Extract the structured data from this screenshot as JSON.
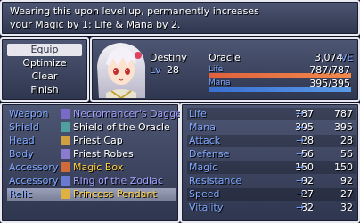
{
  "help": {
    "line1": "Wearing this upon level up, permanently increases",
    "line2": "your Magic by 1: Life & Mana by 2."
  },
  "commands": [
    "Equip",
    "Optimize",
    "Clear",
    "Finish"
  ],
  "actor": {
    "name": "Destiny",
    "class": "Oracle",
    "level_label": "Lv",
    "level": "28",
    "gold": "3,074",
    "currency": "VE",
    "hp_label": "Life",
    "hp": "787/787",
    "hp_fraction": 1.0,
    "mp_label": "Mana",
    "mp": "395/395",
    "mp_fraction": 1.0
  },
  "slots": [
    {
      "slot": "Weapon",
      "item": "Necromancer's Dagger",
      "icon": "dagger-icon",
      "color": "#a0a0ff"
    },
    {
      "slot": "Shield",
      "item": "Shield of the Oracle",
      "icon": "shield-icon",
      "color": "#ffffff"
    },
    {
      "slot": "Head",
      "item": "Priest Cap",
      "icon": "cap-icon",
      "color": "#ffffff"
    },
    {
      "slot": "Body",
      "item": "Priest Robes",
      "icon": "robe-icon",
      "color": "#ffffff"
    },
    {
      "slot": "Accessory",
      "item": "Magic Box",
      "icon": "box-icon",
      "color": "#ffd040"
    },
    {
      "slot": "Accessory",
      "item": "Ring of the Zodiac",
      "icon": "ring-icon",
      "color": "#a0a0ff"
    },
    {
      "slot": "Relic",
      "item": "Princess Pendant",
      "icon": "pendant-icon",
      "color": "#ffd040"
    }
  ],
  "params": [
    {
      "name": "Life",
      "cur": "787",
      "arrow": "→",
      "new": "787"
    },
    {
      "name": "Mana",
      "cur": "395",
      "arrow": "→",
      "new": "395"
    },
    {
      "name": "Attack",
      "cur": "28",
      "arrow": "→",
      "new": "28"
    },
    {
      "name": "Defense",
      "cur": "56",
      "arrow": "→",
      "new": "56"
    },
    {
      "name": "Magic",
      "cur": "150",
      "arrow": "→",
      "new": "150"
    },
    {
      "name": "Resistance",
      "cur": "92",
      "arrow": "→",
      "new": "92"
    },
    {
      "name": "Speed",
      "cur": "27",
      "arrow": "→",
      "new": "27"
    },
    {
      "name": "Vitality",
      "cur": "32",
      "arrow": "→",
      "new": "32"
    }
  ],
  "colors": {
    "hp_bar": "#e86a3a",
    "mp_bar": "#4a7ed8",
    "system_label": "#80a8ff",
    "gold_unit": "#80a8ff"
  }
}
